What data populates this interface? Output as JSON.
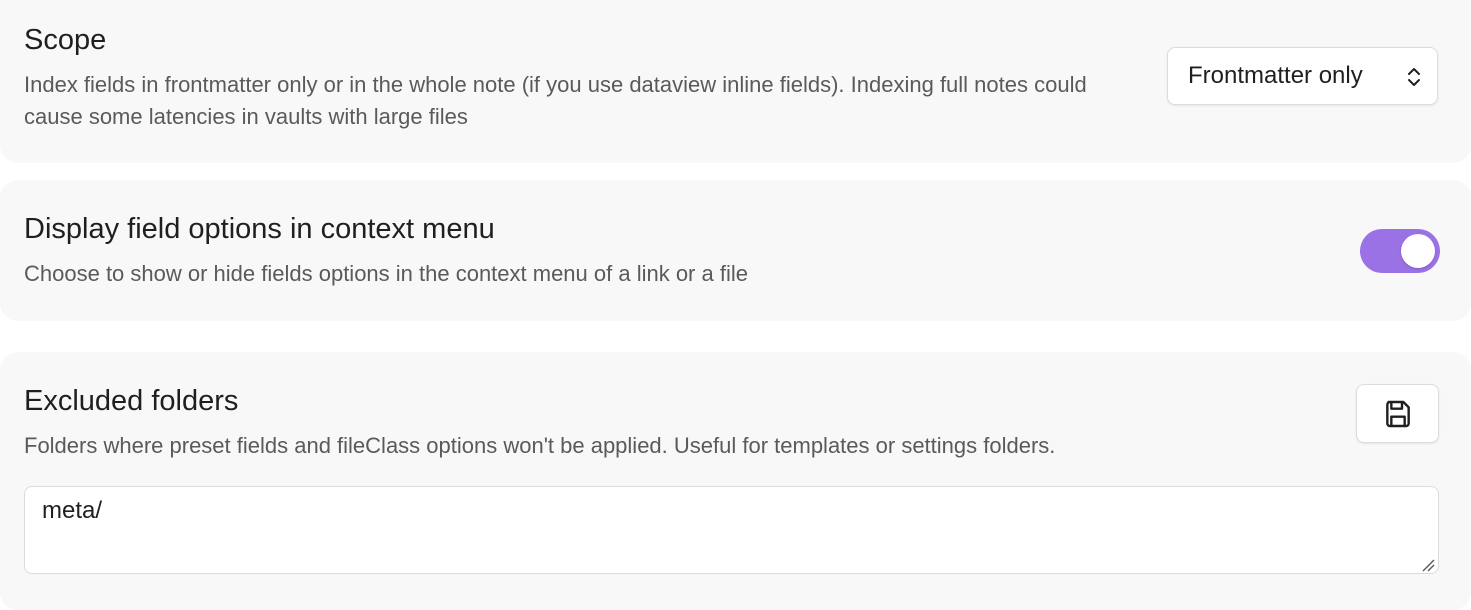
{
  "settings": {
    "scope": {
      "title": "Scope",
      "description": "Index fields in frontmatter only or in the whole note (if you use dataview inline fields). Indexing full notes could cause some latencies in vaults with large files",
      "select_value": "Frontmatter only",
      "select_icon": "up-down-chevron-icon"
    },
    "context_menu": {
      "title": "Display field options in context menu",
      "description": "Choose to show or hide fields options in the context menu of a link or a file",
      "toggle_on": true,
      "toggle_color": "#9b71e6"
    },
    "excluded_folders": {
      "title": "Excluded folders",
      "description": "Folders where preset fields and fileClass options won't be applied. Useful for templates or settings folders.",
      "save_icon": "save-icon",
      "textarea_value": "meta/"
    }
  }
}
